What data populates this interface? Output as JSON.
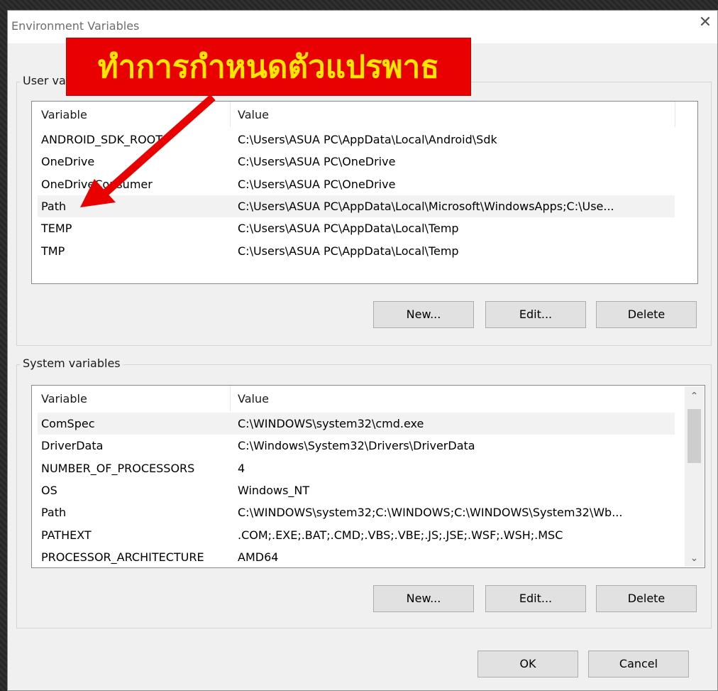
{
  "window": {
    "title": "Environment Variables",
    "close_label": "✕"
  },
  "annotation": {
    "text": "ทำการกำหนดตัวแปรพาธ",
    "color": "#e90000",
    "text_color": "#ffe600"
  },
  "user_group": {
    "label": "User va",
    "columns": [
      "Variable",
      "Value"
    ],
    "rows": [
      {
        "variable": "ANDROID_SDK_ROOT",
        "value": "C:\\Users\\ASUA PC\\AppData\\Local\\Android\\Sdk"
      },
      {
        "variable": "OneDrive",
        "value": "C:\\Users\\ASUA PC\\OneDrive"
      },
      {
        "variable": "OneDriveConsumer",
        "value": "C:\\Users\\ASUA PC\\OneDrive"
      },
      {
        "variable": "Path",
        "value": "C:\\Users\\ASUA PC\\AppData\\Local\\Microsoft\\WindowsApps;C:\\Use..."
      },
      {
        "variable": "TEMP",
        "value": "C:\\Users\\ASUA PC\\AppData\\Local\\Temp"
      },
      {
        "variable": "TMP",
        "value": "C:\\Users\\ASUA PC\\AppData\\Local\\Temp"
      }
    ],
    "selected_index": 3,
    "buttons": {
      "new": "New...",
      "edit": "Edit...",
      "delete": "Delete"
    }
  },
  "system_group": {
    "label": "System variables",
    "columns": [
      "Variable",
      "Value"
    ],
    "rows": [
      {
        "variable": "ComSpec",
        "value": "C:\\WINDOWS\\system32\\cmd.exe"
      },
      {
        "variable": "DriverData",
        "value": "C:\\Windows\\System32\\Drivers\\DriverData"
      },
      {
        "variable": "NUMBER_OF_PROCESSORS",
        "value": "4"
      },
      {
        "variable": "OS",
        "value": "Windows_NT"
      },
      {
        "variable": "Path",
        "value": "C:\\WINDOWS\\system32;C:\\WINDOWS;C:\\WINDOWS\\System32\\Wb..."
      },
      {
        "variable": "PATHEXT",
        "value": ".COM;.EXE;.BAT;.CMD;.VBS;.VBE;.JS;.JSE;.WSF;.WSH;.MSC"
      },
      {
        "variable": "PROCESSOR_ARCHITECTURE",
        "value": "AMD64"
      }
    ],
    "selected_index": 0,
    "buttons": {
      "new": "New...",
      "edit": "Edit...",
      "delete": "Delete"
    }
  },
  "footer": {
    "ok": "OK",
    "cancel": "Cancel"
  }
}
